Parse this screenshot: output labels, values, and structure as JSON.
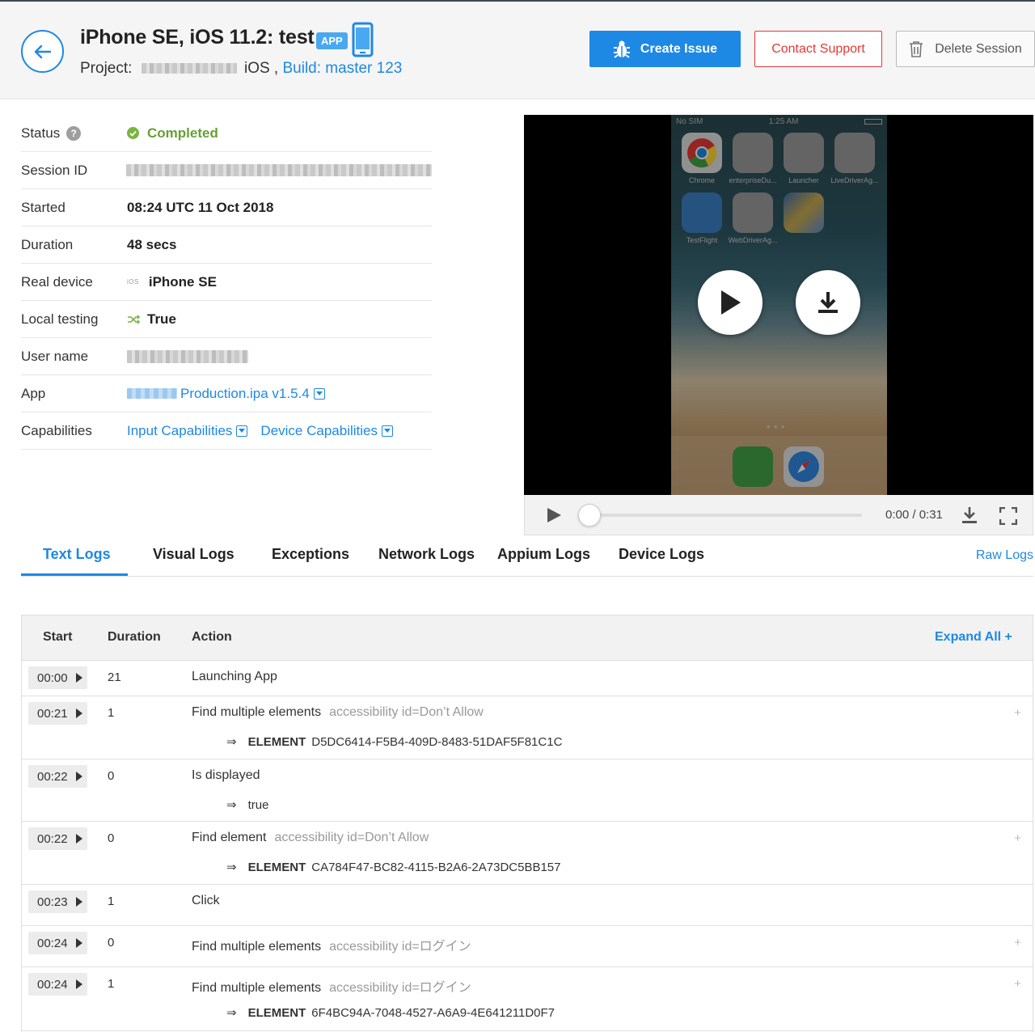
{
  "header": {
    "title": "iPhone SE, iOS 11.2: test",
    "app_badge": "APP",
    "project_label": "Project:",
    "project_os": "iOS ,",
    "build_link": "Build: master 123",
    "create_issue": "Create Issue",
    "contact_support": "Contact Support",
    "delete_session": "Delete Session"
  },
  "info": {
    "status_label": "Status",
    "status_help": "?",
    "status_value": "Completed",
    "session_label": "Session ID",
    "started_label": "Started",
    "started_value": "08:24 UTC 11 Oct 2018",
    "duration_label": "Duration",
    "duration_value": "48 secs",
    "device_label": "Real device",
    "device_os_tag": "iOS",
    "device_value": "iPhone SE",
    "local_label": "Local testing",
    "local_value": "True",
    "user_label": "User name",
    "app_label": "App",
    "app_value": "Production.ipa v1.5.4",
    "caps_label": "Capabilities",
    "caps_input": "Input Capabilities",
    "caps_device": "Device Capabilities"
  },
  "video": {
    "carrier": "No SIM",
    "clock": "1:25 AM",
    "apps": [
      "Chrome",
      "enterpriseDu...",
      "Launcher",
      "LiveDriverAg...",
      "TestFlight",
      "WebDriverAg..."
    ],
    "time": "0:00 / 0:31"
  },
  "tabs": {
    "items": [
      "Text Logs",
      "Visual Logs",
      "Exceptions",
      "Network Logs",
      "Appium Logs",
      "Device Logs"
    ],
    "raw_logs": "Raw Logs"
  },
  "logs": {
    "headers": {
      "start": "Start",
      "duration": "Duration",
      "action": "Action",
      "expand_all": "Expand All +"
    },
    "result_arrow": "⇒",
    "element_keyword": "ELEMENT",
    "expand_glyph": "+",
    "rows": [
      {
        "start": "00:00",
        "duration": "21",
        "action": "Launching App",
        "selector": "",
        "result": "",
        "result_element": ""
      },
      {
        "start": "00:21",
        "duration": "1",
        "action": "Find multiple elements",
        "selector": "accessibility id=Don’t Allow",
        "result": "",
        "result_element": "D5DC6414-F5B4-409D-8483-51DAF5F81C1C"
      },
      {
        "start": "00:22",
        "duration": "0",
        "action": "Is displayed",
        "selector": "",
        "result": "true",
        "result_element": ""
      },
      {
        "start": "00:22",
        "duration": "0",
        "action": "Find element",
        "selector": "accessibility id=Don’t Allow",
        "result": "",
        "result_element": "CA784F47-BC82-4115-B2A6-2A73DC5BB157"
      },
      {
        "start": "00:23",
        "duration": "1",
        "action": "Click",
        "selector": "",
        "result": "",
        "result_element": ""
      },
      {
        "start": "00:24",
        "duration": "0",
        "action": "Find multiple elements",
        "selector": "accessibility id=ログイン",
        "result": "",
        "result_element": ""
      },
      {
        "start": "00:24",
        "duration": "1",
        "action": "Find multiple elements",
        "selector": "accessibility id=ログイン",
        "result": "",
        "result_element": "6F4BC94A-7048-4527-A6A9-4E641211D0F7"
      }
    ]
  },
  "colors": {
    "accent": "#1e88e5",
    "success": "#7cb342",
    "danger": "#e53935"
  },
  "icons": [
    "back-arrow-icon",
    "phone-icon",
    "bug-icon",
    "trash-icon",
    "help-icon",
    "check-circle-icon",
    "shuffle-icon",
    "dropdown-icon",
    "play-icon",
    "download-icon",
    "fullscreen-icon"
  ]
}
